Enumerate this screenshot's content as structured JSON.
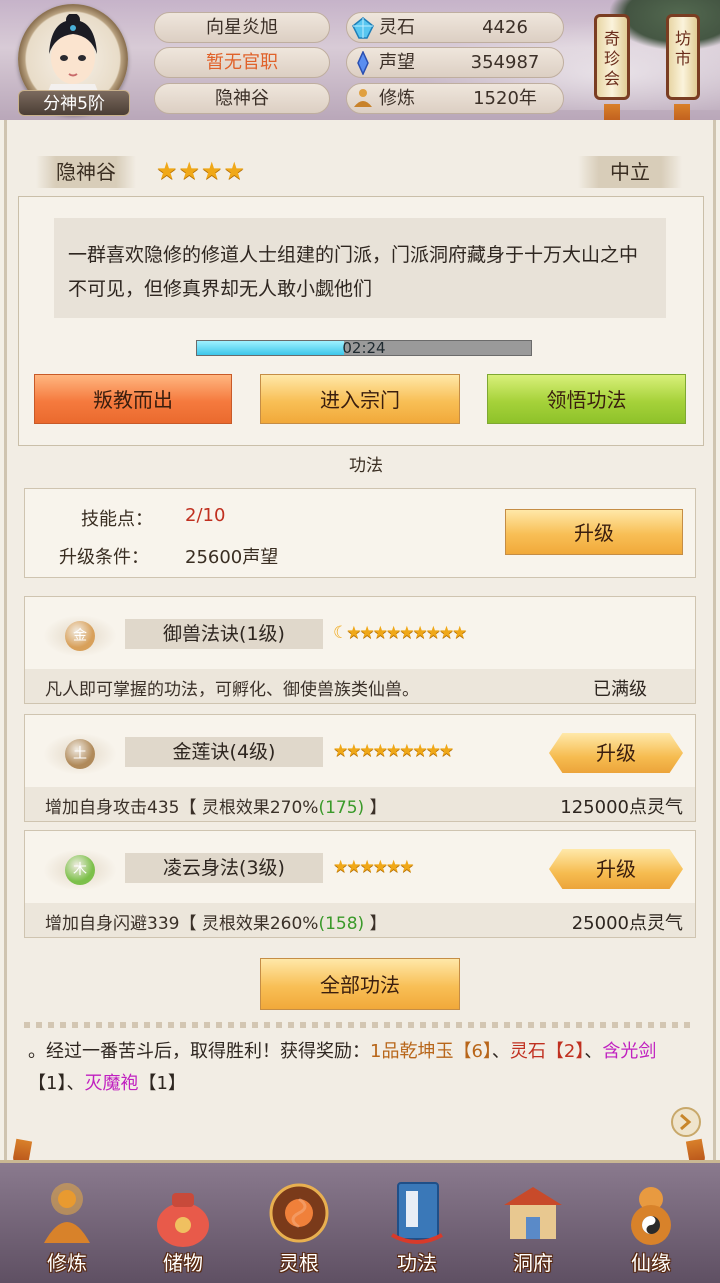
{
  "header": {
    "player_name": "向星炎旭",
    "office": "暂无官职",
    "sect": "隐神谷",
    "rank": "分神5阶",
    "resources": [
      {
        "label": "灵石",
        "value": "4426",
        "icon": "spirit-stone-icon"
      },
      {
        "label": "声望",
        "value": "354987",
        "icon": "prestige-crystal-icon"
      },
      {
        "label": "修炼",
        "value": "1520年",
        "icon": "meditation-icon"
      }
    ],
    "shop_buttons": [
      {
        "label": "奇珍会"
      },
      {
        "label": "坊市"
      }
    ]
  },
  "sect_info": {
    "name": "隐神谷",
    "stars": "★★★★",
    "stance": "中立",
    "description": "一群喜欢隐修的修道人士组建的门派，门派洞府藏身于十万大山之中不可见，但修真界却无人敢小觑他们",
    "timer": "02:24",
    "timer_progress": 0.44,
    "actions": {
      "betray": "叛教而出",
      "enter": "进入宗门",
      "learn": "领悟功法"
    }
  },
  "gongfa": {
    "title": "功法",
    "skill_points_label": "技能点：",
    "skill_points_value": "2/10",
    "upgrade_cond_label": "升级条件：",
    "upgrade_cond_value": "25600声望",
    "upgrade_button": "升级",
    "skills": [
      {
        "element": "金",
        "element_color": "#d8a05a",
        "name": "御兽法诀(1级)",
        "stars": "★★★★★★★★★",
        "has_moon": true,
        "desc": "凡人即可掌握的功法，可孵化、御使兽族类仙兽。",
        "desc_extra": "",
        "desc_bonus": "",
        "desc_tail": "",
        "cost": "已满级",
        "button": ""
      },
      {
        "element": "土",
        "element_color": "#b08a5a",
        "name": "金莲诀(4级)",
        "stars": "★★★★★★★★★",
        "has_moon": false,
        "desc": "增加自身攻击435【 灵根效果270%",
        "desc_bonus": "(175)",
        "desc_tail": " 】",
        "cost": "125000点灵气",
        "button": "升级"
      },
      {
        "element": "木",
        "element_color": "#7cc04a",
        "name": "凌云身法(3级)",
        "stars": "★★★★★★",
        "has_moon": false,
        "desc": "增加自身闪避339【 灵根效果260%",
        "desc_bonus": "(158)",
        "desc_tail": " 】",
        "cost": "25000点灵气",
        "button": "升级"
      }
    ],
    "all_button": "全部功法"
  },
  "battle_log": {
    "prefix": "。经过一番苦斗后，取得胜利！获得奖励：",
    "item1": "1品乾坤玉",
    "item1_count": "【6】",
    "sep1": "、",
    "item2": "灵石",
    "item2_count": "【2】",
    "sep2": "、",
    "item3": "含光剑",
    "item3_count": "【1】",
    "sep3": "、",
    "item4": "灭魔袍",
    "item4_count": "【1】"
  },
  "nav": [
    {
      "label": "修炼",
      "icon": "cultivate-icon"
    },
    {
      "label": "储物",
      "icon": "storage-bag-icon"
    },
    {
      "label": "灵根",
      "icon": "spirit-root-icon"
    },
    {
      "label": "功法",
      "icon": "skill-book-icon"
    },
    {
      "label": "洞府",
      "icon": "cave-house-icon"
    },
    {
      "label": "仙缘",
      "icon": "destiny-gourd-icon"
    }
  ],
  "colors": {
    "accent_orange": "#e0622a",
    "log_item_gold": "#b8661a",
    "log_item_red": "#c03020",
    "log_item_magenta": "#c020c0",
    "bonus_green": "#3a9a2a"
  }
}
